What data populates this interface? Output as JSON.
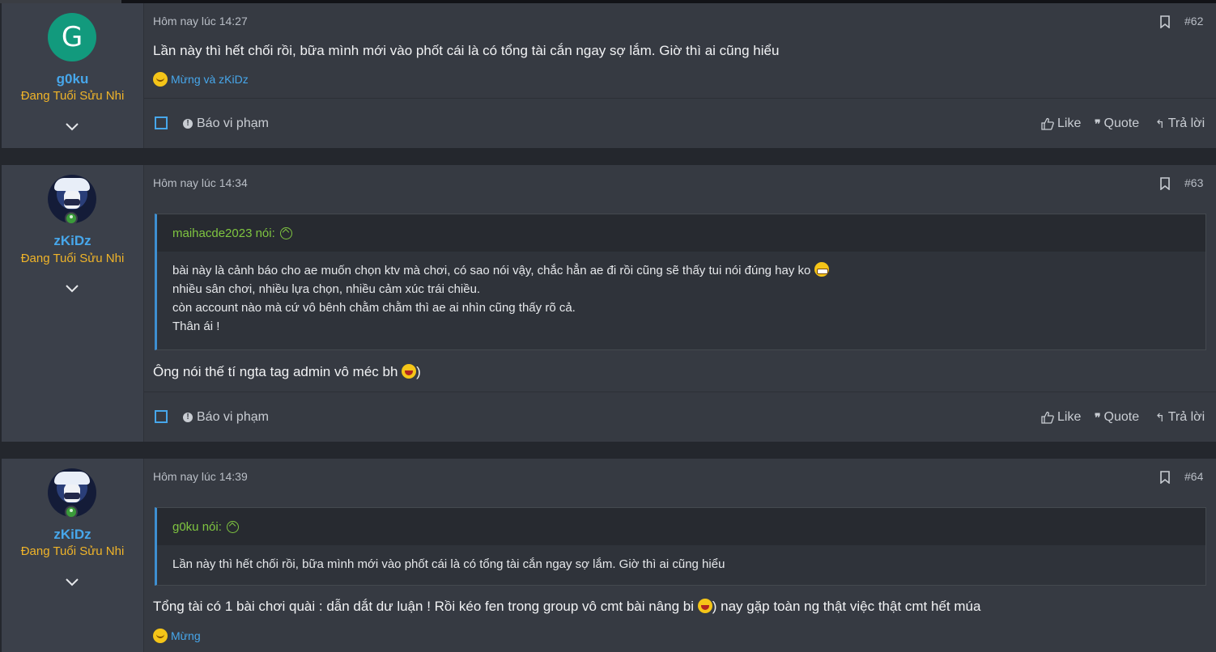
{
  "posts": [
    {
      "avatar_letter": "G",
      "username": "g0ku",
      "user_title": "Đang Tuổi Sửu Nhi",
      "time": "Hôm nay lúc 14:27",
      "post_number": "#62",
      "content": "Lần này thì hết chối rồi, bữa mình mới vào phốt cái là có tổng tài cắn ngay sợ lắm. Giờ thì ai cũng hiểu",
      "reactions": "Mừng và zKiDz"
    },
    {
      "username": "zKiDz",
      "user_title": "Đang Tuổi Sửu Nhi",
      "time": "Hôm nay lúc 14:34",
      "post_number": "#63",
      "quote_author": "maihacde2023 nói:",
      "quote_lines": [
        "bài này là cảnh báo cho ae muốn chọn ktv mà chơi, có sao nói vậy, chắc hẳn ae đi rồi cũng sẽ thấy tui nói đúng hay ko",
        "nhiều sân chơi, nhiều lựa chọn, nhiều cảm xúc trái chiều.",
        "còn account nào mà cứ vô bênh chằm chằm thì ae ai nhìn cũng thấy rõ cả.",
        "Thân ái !"
      ],
      "content_before_emoji": "Ông nói thế tí ngta tag admin vô méc bh",
      "content_after_emoji": ")"
    },
    {
      "username": "zKiDz",
      "user_title": "Đang Tuổi Sửu Nhi",
      "time": "Hôm nay lúc 14:39",
      "post_number": "#64",
      "quote_author": "g0ku nói:",
      "quote_lines": [
        "Lần này thì hết chối rồi, bữa mình mới vào phốt cái là có tổng tài cắn ngay sợ lắm. Giờ thì ai cũng hiểu"
      ],
      "content_before_emoji": "Tổng tài có 1 bài chơi quài : dẫn dắt dư luận ! Rồi kéo fen trong group vô cmt bài nâng bi",
      "content_after_emoji": ") nay gặp toàn ng thật việc thật cmt hết múa",
      "reactions": "Mừng"
    }
  ],
  "actions": {
    "report": "Báo vi phạm",
    "like": "Like",
    "quote": "Quote",
    "reply": "Trả lời"
  },
  "colors": {
    "username": "#47a7eb",
    "user_title": "#f0b429",
    "quote_author": "#7fc540",
    "avatar_g0ku": "#129a7d"
  }
}
